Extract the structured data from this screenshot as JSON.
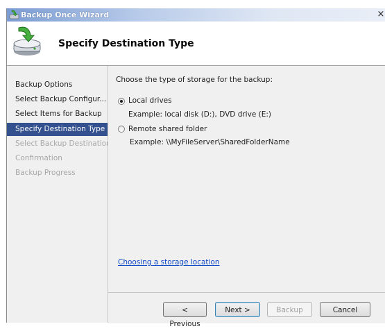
{
  "window": {
    "title": "Backup Once Wizard",
    "close_glyph": "×"
  },
  "header": {
    "title": "Specify Destination Type",
    "icon": "backup-disk-arrow-icon"
  },
  "sidebar": {
    "steps": [
      {
        "label": "Backup Options",
        "state": "enabled"
      },
      {
        "label": "Select Backup Configur...",
        "state": "enabled"
      },
      {
        "label": "Select Items for Backup",
        "state": "enabled"
      },
      {
        "label": "Specify Destination Type",
        "state": "active"
      },
      {
        "label": "Select Backup Destination",
        "state": "disabled"
      },
      {
        "label": "Confirmation",
        "state": "disabled"
      },
      {
        "label": "Backup Progress",
        "state": "disabled"
      }
    ]
  },
  "content": {
    "prompt": "Choose the type of storage for the backup:",
    "options": [
      {
        "label": "Local drives",
        "example": "Example: local disk (D:), DVD drive (E:)",
        "selected": true
      },
      {
        "label": "Remote shared folder",
        "example": "Example: \\\\MyFileServer\\SharedFolderName",
        "selected": false
      }
    ],
    "help_link": "Choosing a storage location"
  },
  "buttons": {
    "previous": "< Previous",
    "next": "Next >",
    "backup": "Backup",
    "cancel": "Cancel"
  },
  "colors": {
    "active_step_bg": "#33508f",
    "link": "#0b46c4",
    "disabled_text": "#a8a8a8"
  }
}
